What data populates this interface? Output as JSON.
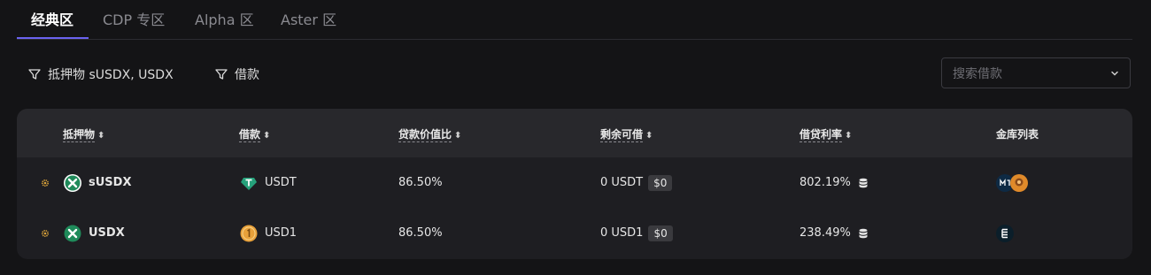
{
  "tabs": [
    {
      "label": "经典区",
      "active": true
    },
    {
      "label": "CDP 专区",
      "active": false
    },
    {
      "label": "Alpha 区",
      "active": false
    },
    {
      "label": "Aster 区",
      "active": false
    }
  ],
  "filters": {
    "collateral": "抵押物 sUSDX, USDX",
    "borrow": "借款"
  },
  "search": {
    "placeholder": "搜索借款"
  },
  "table": {
    "headers": [
      "抵押物",
      "借款",
      "贷款价值比",
      "剩余可借",
      "借贷利率",
      "金库列表"
    ],
    "sort_glyph": "⬍",
    "rows": [
      {
        "collateral": "sUSDX",
        "borrow": "USDT",
        "ltv": "86.50%",
        "remaining": "0 USDT",
        "remaining_usd": "$0",
        "rate": "802.19%"
      },
      {
        "collateral": "USDX",
        "borrow": "USD1",
        "ltv": "86.50%",
        "remaining": "0 USD1",
        "remaining_usd": "$0",
        "rate": "238.49%"
      }
    ]
  },
  "colors": {
    "accent": "#6a63f0",
    "usdt": "#26a17b",
    "usd1": "#e8a13a",
    "usdx": "#1f8a5a"
  },
  "icons": [
    "filter-icon",
    "chevron-down-icon",
    "gear-icon",
    "usdx-logo-icon",
    "usdt-logo-icon",
    "usd1-logo-icon",
    "database-icon",
    "vault-logo-icon"
  ]
}
